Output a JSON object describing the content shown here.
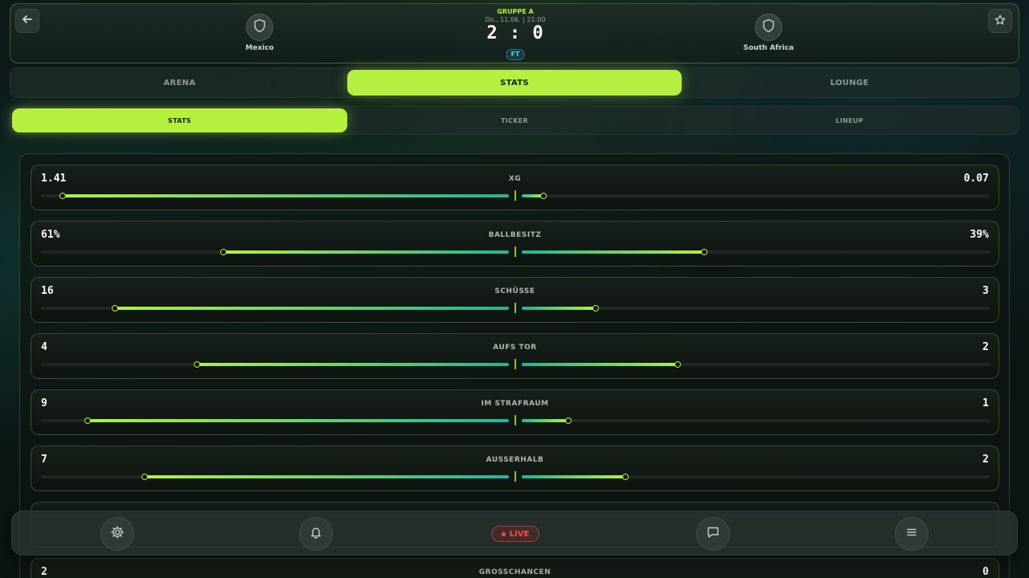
{
  "match": {
    "group": "GRUPPE A",
    "datetime": "Do., 11.06. | 21:00",
    "score": "2 : 0",
    "status": "FT",
    "home": {
      "name": "Mexico",
      "icon": "shield-icon"
    },
    "away": {
      "name": "South Africa",
      "icon": "shield-icon"
    }
  },
  "header_icons": {
    "back": "arrow-left-icon",
    "favorite": "star-icon"
  },
  "main_tabs": [
    {
      "label": "ARENA",
      "active": false
    },
    {
      "label": "STATS",
      "active": true
    },
    {
      "label": "LOUNGE",
      "active": false
    }
  ],
  "sub_tabs": [
    {
      "label": "STATS",
      "active": true
    },
    {
      "label": "TICKER",
      "active": false
    },
    {
      "label": "LINEUP",
      "active": false
    }
  ],
  "stats": [
    {
      "label": "XG",
      "home": "1.41",
      "away": "0.07",
      "home_ratio": 0.953,
      "away_ratio": 0.047
    },
    {
      "label": "BALLBESITZ",
      "home": "61%",
      "away": "39%",
      "home_ratio": 0.61,
      "away_ratio": 0.39
    },
    {
      "label": "SCHÜSSE",
      "home": "16",
      "away": "3",
      "home_ratio": 0.842,
      "away_ratio": 0.158
    },
    {
      "label": "AUFS TOR",
      "home": "4",
      "away": "2",
      "home_ratio": 0.667,
      "away_ratio": 0.333
    },
    {
      "label": "IM STRAFRAUM",
      "home": "9",
      "away": "1",
      "home_ratio": 0.9,
      "away_ratio": 0.1
    },
    {
      "label": "AUSSERHALB",
      "home": "7",
      "away": "2",
      "home_ratio": 0.778,
      "away_ratio": 0.222
    },
    {
      "label": "",
      "home": "",
      "away": "",
      "home_ratio": 0,
      "away_ratio": 0
    },
    {
      "label": "GROSSCHANCEN",
      "home": "2",
      "away": "0",
      "home_ratio": 1.0,
      "away_ratio": 0.0
    }
  ],
  "bottom_nav": {
    "live_label": "LIVE",
    "icons": [
      "gear-icon",
      "bell-icon",
      "chat-icon",
      "menu-icon"
    ]
  },
  "colors": {
    "accent": "#b5f03f",
    "teal": "#20b59c",
    "live": "#ff4a4a"
  }
}
